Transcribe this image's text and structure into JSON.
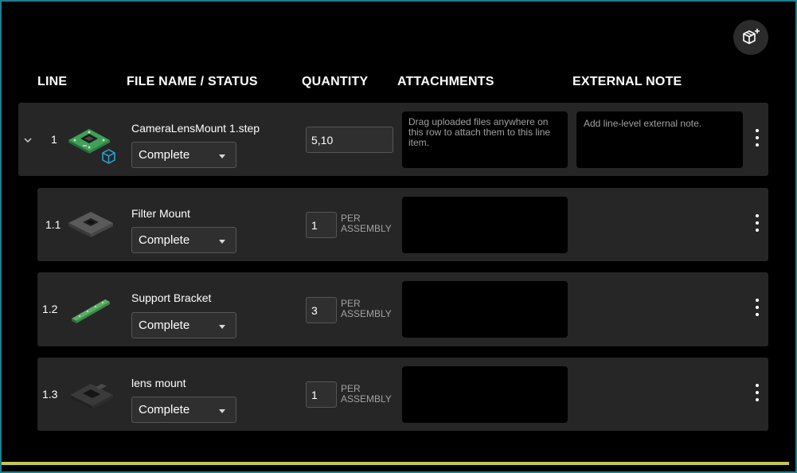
{
  "headers": {
    "line": "LINE",
    "file_name_status": "FILE NAME / STATUS",
    "quantity": "QUANTITY",
    "attachments": "ATTACHMENTS",
    "external_note": "EXTERNAL NOTE"
  },
  "toolbar": {
    "add_part_icon": "box-plus-icon"
  },
  "main_row": {
    "line": "1",
    "file_name": "CameraLensMount 1.step",
    "status": "Complete",
    "quantity": "5,10",
    "attachments_placeholder": "Drag uploaded files anywhere on this row to attach them to this line item.",
    "note_placeholder": "Add line-level external note.",
    "expand_icon": "chevron-down-icon",
    "model_icon": "3d-box-icon"
  },
  "sub_rows": [
    {
      "line": "1.1",
      "file_name": "Filter Mount",
      "status": "Complete",
      "quantity": "1",
      "per_label": "PER ASSEMBLY"
    },
    {
      "line": "1.2",
      "file_name": "Support Bracket",
      "status": "Complete",
      "quantity": "3",
      "per_label": "PER ASSEMBLY"
    },
    {
      "line": "1.3",
      "file_name": "lens mount",
      "status": "Complete",
      "quantity": "1",
      "per_label": "PER ASSEMBLY"
    }
  ],
  "colors": {
    "background": "#000000",
    "row_bg": "#262626",
    "accent_bar": "#c6c848",
    "frame_border": "#1e7f8f",
    "model_icon": "#2aa6d6"
  }
}
